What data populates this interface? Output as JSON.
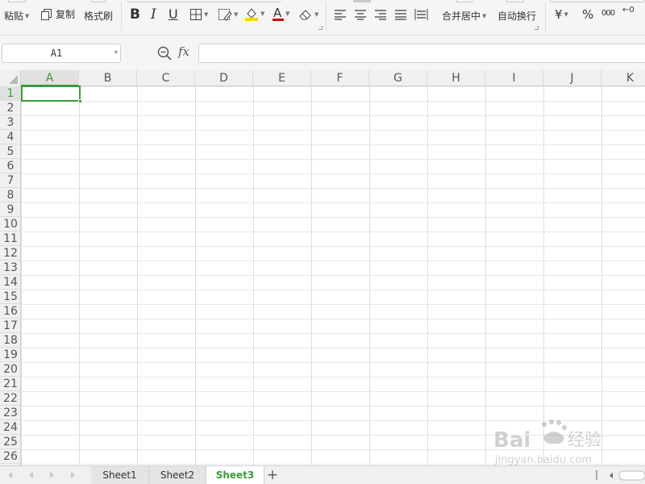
{
  "toolbar": {
    "paste_label": "粘贴",
    "copy_label": "复制",
    "format_painter_label": "格式刷",
    "merge_center_label": "合并居中",
    "wrap_text_label": "自动换行",
    "currency_symbol": "¥",
    "percent_symbol": "%",
    "thousands_symbol": "000",
    "decimal_symbol": "←0",
    "bold_glyph": "B",
    "italic_glyph": "I",
    "underline_glyph": "U",
    "font_color_glyph": "A",
    "accent_color": "#cc0000",
    "fill_color": "#ffd700"
  },
  "formula_bar": {
    "name_box_value": "A1",
    "fx_label": "fx",
    "formula_value": ""
  },
  "grid": {
    "columns": [
      "A",
      "B",
      "C",
      "D",
      "E",
      "F",
      "G",
      "H",
      "I",
      "J",
      "K"
    ],
    "rows": [
      "1",
      "2",
      "3",
      "4",
      "5",
      "6",
      "7",
      "8",
      "9",
      "10",
      "11",
      "12",
      "13",
      "14",
      "15",
      "16",
      "17",
      "18",
      "19",
      "20",
      "21",
      "22",
      "23",
      "24",
      "25",
      "26"
    ],
    "selected_cell": "A1",
    "selection_color": "#3a9b3a"
  },
  "sheets": {
    "tabs": [
      "Sheet1",
      "Sheet2",
      "Sheet3"
    ],
    "active": "Sheet3",
    "add_label": "+"
  },
  "watermark": {
    "brand": "Bai",
    "brand_cn": "经验",
    "url": "jingyan.baidu.com"
  }
}
